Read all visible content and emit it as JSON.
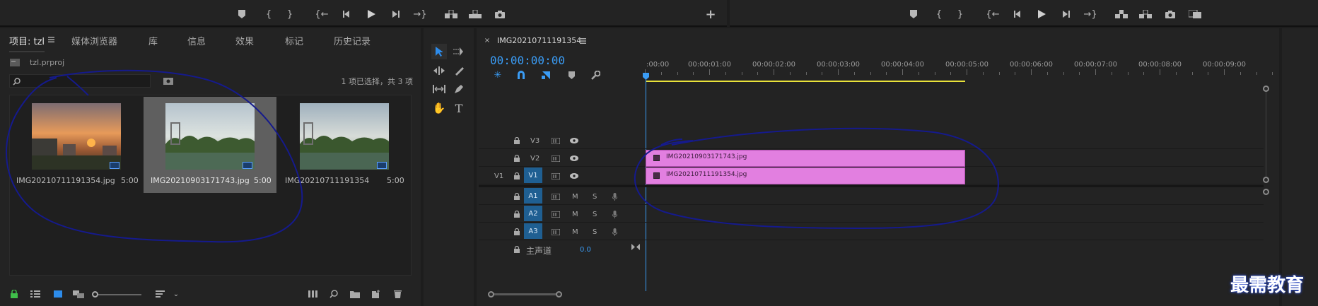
{
  "source_monitor": {
    "icons": [
      "marker-icon",
      "mark-in-icon",
      "mark-out-icon",
      "go-to-in-icon",
      "step-back-icon",
      "play-icon",
      "step-forward-icon",
      "go-to-out-icon",
      "insert-icon",
      "overwrite-icon",
      "export-frame-icon",
      "add-button-icon"
    ]
  },
  "program_monitor": {
    "icons": [
      "marker-icon",
      "mark-in-icon",
      "mark-out-icon",
      "go-to-in-icon",
      "step-back-icon",
      "play-icon",
      "step-forward-icon",
      "go-to-out-icon",
      "lift-icon",
      "extract-icon",
      "export-frame-icon",
      "compare-icon"
    ]
  },
  "project_panel": {
    "tabs": [
      "项目: tzl",
      "媒体浏览器",
      "库",
      "信息",
      "效果",
      "标记",
      "历史记录"
    ],
    "project_file": "tzl.prproj",
    "search_placeholder": "",
    "selection_status": "1 项已选择，共 3 项",
    "items": [
      {
        "name": "IMG20210711191354.jpg",
        "duration": "5:00",
        "selected": false
      },
      {
        "name": "IMG20210903171743.jpg",
        "duration": "5:00",
        "selected": true
      },
      {
        "name": "IMG20210711191354",
        "duration": "5:00",
        "selected": false
      }
    ]
  },
  "timeline": {
    "sequence_name": "IMG20210711191354",
    "timecode": "00:00:00:00",
    "ruler_labels": [
      ":00:00",
      "00:00:01:00",
      "00:00:02:00",
      "00:00:03:00",
      "00:00:04:00",
      "00:00:05:00",
      "00:00:06:00",
      "00:00:07:00",
      "00:00:08:00",
      "00:00:09:00"
    ],
    "video_tracks": [
      "V3",
      "V2",
      "V1"
    ],
    "source_patch": "V1",
    "audio_tracks": [
      "A1",
      "A2",
      "A3"
    ],
    "mute_label": "M",
    "solo_label": "S",
    "master_label": "主声道",
    "master_value": "0.0",
    "clips": [
      {
        "track": "V2",
        "name": "IMG20210903171743.jpg"
      },
      {
        "track": "V1",
        "name": "IMG20210711191354.jpg"
      }
    ]
  },
  "watermark": "最需教育",
  "colors": {
    "accent_blue": "#2d8ceb",
    "clip_pink": "#e27fe0",
    "work_area_yellow": "#e9e23a",
    "annotation_ink": "#151a8c"
  }
}
